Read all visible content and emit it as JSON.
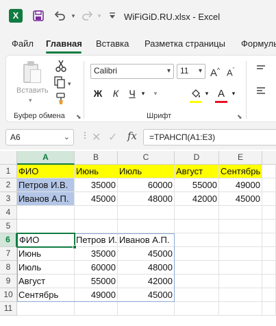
{
  "app": {
    "logo": "X",
    "title": "WiFiGiD.RU.xlsx  -  Excel"
  },
  "quick_access": {
    "save_icon": "save-icon",
    "undo_icon": "undo-icon",
    "redo_icon": "redo-icon",
    "customize_icon": "customize-qat-icon"
  },
  "tabs": [
    "Файл",
    "Главная",
    "Вставка",
    "Разметка страницы",
    "Формулы"
  ],
  "active_tab": "Главная",
  "ribbon": {
    "clipboard": {
      "paste_label": "Вставить",
      "group_label": "Буфер обмена"
    },
    "font": {
      "font_name": "Calibri",
      "font_size": "11",
      "bold": "Ж",
      "italic": "К",
      "underline": "Ч",
      "font_color_letter": "A",
      "grow": "A^",
      "shrink": "Aˇ",
      "group_label": "Шрифт",
      "fill_color": "#ffff00",
      "font_color": "#e81123"
    }
  },
  "formula_bar": {
    "name_box": "A6",
    "fx": "fx",
    "formula": "=ТРАНСП(A1:E3)"
  },
  "grid": {
    "columns": [
      "A",
      "B",
      "C",
      "D",
      "E"
    ],
    "active_column": "A",
    "rows": [
      "1",
      "2",
      "3",
      "4",
      "5",
      "6",
      "7",
      "8",
      "9",
      "10",
      "11"
    ],
    "active_row": "6",
    "cells": {
      "A1": "ФИО",
      "B1": "Июнь",
      "C1": "Июль",
      "D1": "Август",
      "E1": "Сентябрь",
      "A2": "Петров И.В.",
      "B2": "35000",
      "C2": "60000",
      "D2": "55000",
      "E2": "49000",
      "A3": "Иванов А.П.",
      "B3": "45000",
      "C3": "48000",
      "D3": "42000",
      "E3": "45000",
      "A6": "ФИО",
      "B6": "Петров И.",
      "C6": "Иванов А.П.",
      "A7": "Июнь",
      "B7": "35000",
      "C7": "45000",
      "A8": "Июль",
      "B8": "60000",
      "C8": "48000",
      "A9": "Август",
      "B9": "55000",
      "C9": "42000",
      "A10": "Сентябрь",
      "B10": "49000",
      "C10": "45000"
    },
    "header_fill": "#ffff00",
    "name_fill": "#b4c6e7",
    "accent": "#107c41"
  }
}
